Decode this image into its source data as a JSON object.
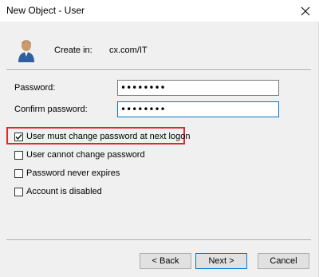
{
  "window": {
    "title": "New Object - User",
    "close_icon": "close-icon"
  },
  "header": {
    "icon": "user-icon",
    "create_in_label": "Create in:",
    "create_in_value": "cx.com/IT"
  },
  "form": {
    "password_label": "Password:",
    "password_value": "••••••••",
    "confirm_label": "Confirm password:",
    "confirm_value": "••••••••"
  },
  "options": [
    {
      "label": "User must change password at next logon",
      "checked": true
    },
    {
      "label": "User cannot change password",
      "checked": false
    },
    {
      "label": "Password never expires",
      "checked": false
    },
    {
      "label": "Account is disabled",
      "checked": false
    }
  ],
  "buttons": {
    "back": "< Back",
    "next": "Next >",
    "cancel": "Cancel"
  },
  "colors": {
    "highlight": "#e0272d",
    "focus": "#0078d7",
    "dialog_bg": "#f0f0f0"
  }
}
